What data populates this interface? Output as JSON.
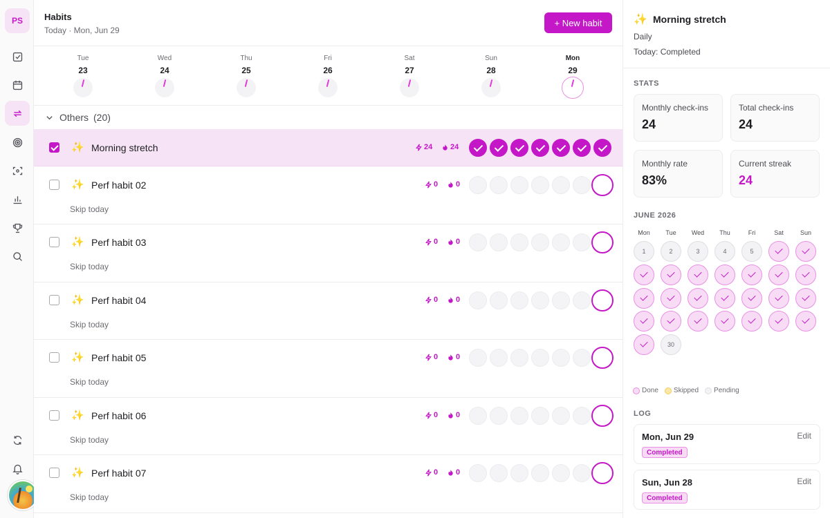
{
  "user": {
    "initials": "PS"
  },
  "header": {
    "title": "Habits",
    "subtitle": "Today · Mon, Jun 29",
    "new_button": "+ New habit"
  },
  "week": [
    {
      "name": "Tue",
      "date": "23"
    },
    {
      "name": "Wed",
      "date": "24"
    },
    {
      "name": "Thu",
      "date": "25"
    },
    {
      "name": "Fri",
      "date": "26"
    },
    {
      "name": "Sat",
      "date": "27"
    },
    {
      "name": "Sun",
      "date": "28"
    },
    {
      "name": "Mon",
      "date": "29"
    }
  ],
  "group": {
    "name": "Others",
    "count": "(20)"
  },
  "habits": [
    {
      "name": "Morning stretch",
      "streak": "24",
      "total": "24",
      "skip": ""
    },
    {
      "name": "Perf habit 02",
      "streak": "0",
      "total": "0",
      "skip": "Skip today"
    },
    {
      "name": "Perf habit 03",
      "streak": "0",
      "total": "0",
      "skip": "Skip today"
    },
    {
      "name": "Perf habit 04",
      "streak": "0",
      "total": "0",
      "skip": "Skip today"
    },
    {
      "name": "Perf habit 05",
      "streak": "0",
      "total": "0",
      "skip": "Skip today"
    },
    {
      "name": "Perf habit 06",
      "streak": "0",
      "total": "0",
      "skip": "Skip today"
    },
    {
      "name": "Perf habit 07",
      "streak": "0",
      "total": "0",
      "skip": "Skip today"
    }
  ],
  "panel": {
    "title": "Morning stretch",
    "frequency": "Daily",
    "today_status": "Today: Completed",
    "stats_heading": "STATS",
    "stats": [
      {
        "label": "Monthly check-ins",
        "value": "24"
      },
      {
        "label": "Total check-ins",
        "value": "24"
      },
      {
        "label": "Monthly rate",
        "value": "83%"
      },
      {
        "label": "Current streak",
        "value": "24"
      }
    ],
    "calendar_heading": "JUNE 2026",
    "weekdays": [
      "Mon",
      "Tue",
      "Wed",
      "Thu",
      "Fri",
      "Sat",
      "Sun"
    ],
    "calendar_numbers": {
      "d1": "1",
      "d2": "2",
      "d3": "3",
      "d4": "4",
      "d5": "5",
      "d30": "30"
    },
    "legend": {
      "done": "Done",
      "skipped": "Skipped",
      "pending": "Pending"
    },
    "log_heading": "LOG",
    "log": [
      {
        "date": "Mon, Jun 29",
        "status": "Completed",
        "edit": "Edit"
      },
      {
        "date": "Sun, Jun 28",
        "status": "Completed",
        "edit": "Edit"
      }
    ]
  },
  "colors": {
    "accent": "#c417c7",
    "accent_soft": "#f6e3f6",
    "sparkle": "#f2b515"
  }
}
